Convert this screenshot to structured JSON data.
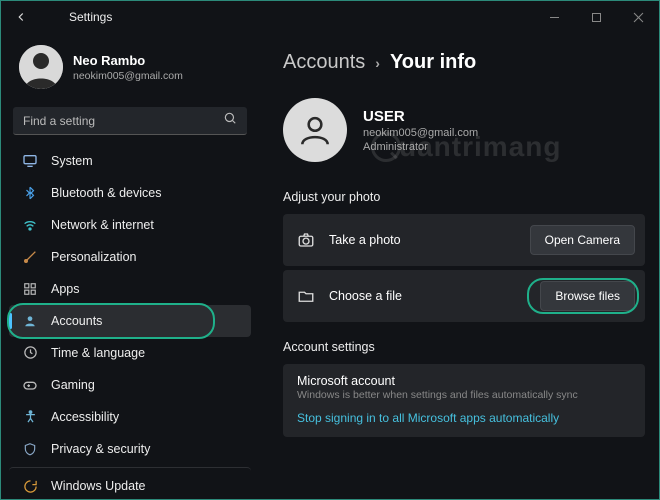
{
  "window": {
    "title": "Settings"
  },
  "profile": {
    "name": "Neo Rambo",
    "email": "neokim005@gmail.com"
  },
  "search": {
    "placeholder": "Find a setting"
  },
  "sidebar": {
    "items": [
      {
        "label": "System"
      },
      {
        "label": "Bluetooth & devices"
      },
      {
        "label": "Network & internet"
      },
      {
        "label": "Personalization"
      },
      {
        "label": "Apps"
      },
      {
        "label": "Accounts"
      },
      {
        "label": "Time & language"
      },
      {
        "label": "Gaming"
      },
      {
        "label": "Accessibility"
      },
      {
        "label": "Privacy & security"
      },
      {
        "label": "Windows Update"
      }
    ]
  },
  "breadcrumb": {
    "parent": "Accounts",
    "current": "Your info"
  },
  "user": {
    "name": "USER",
    "email": "neokim005@gmail.com",
    "role": "Administrator"
  },
  "photo": {
    "sectionTitle": "Adjust your photo",
    "takeLabel": "Take a photo",
    "takeAction": "Open Camera",
    "chooseLabel": "Choose a file",
    "chooseAction": "Browse files"
  },
  "accountSettings": {
    "sectionTitle": "Account settings",
    "msTitle": "Microsoft account",
    "msSub": "Windows is better when settings and files automatically sync",
    "msLink": "Stop signing in to all Microsoft apps automatically"
  },
  "watermark": "uantrimang"
}
